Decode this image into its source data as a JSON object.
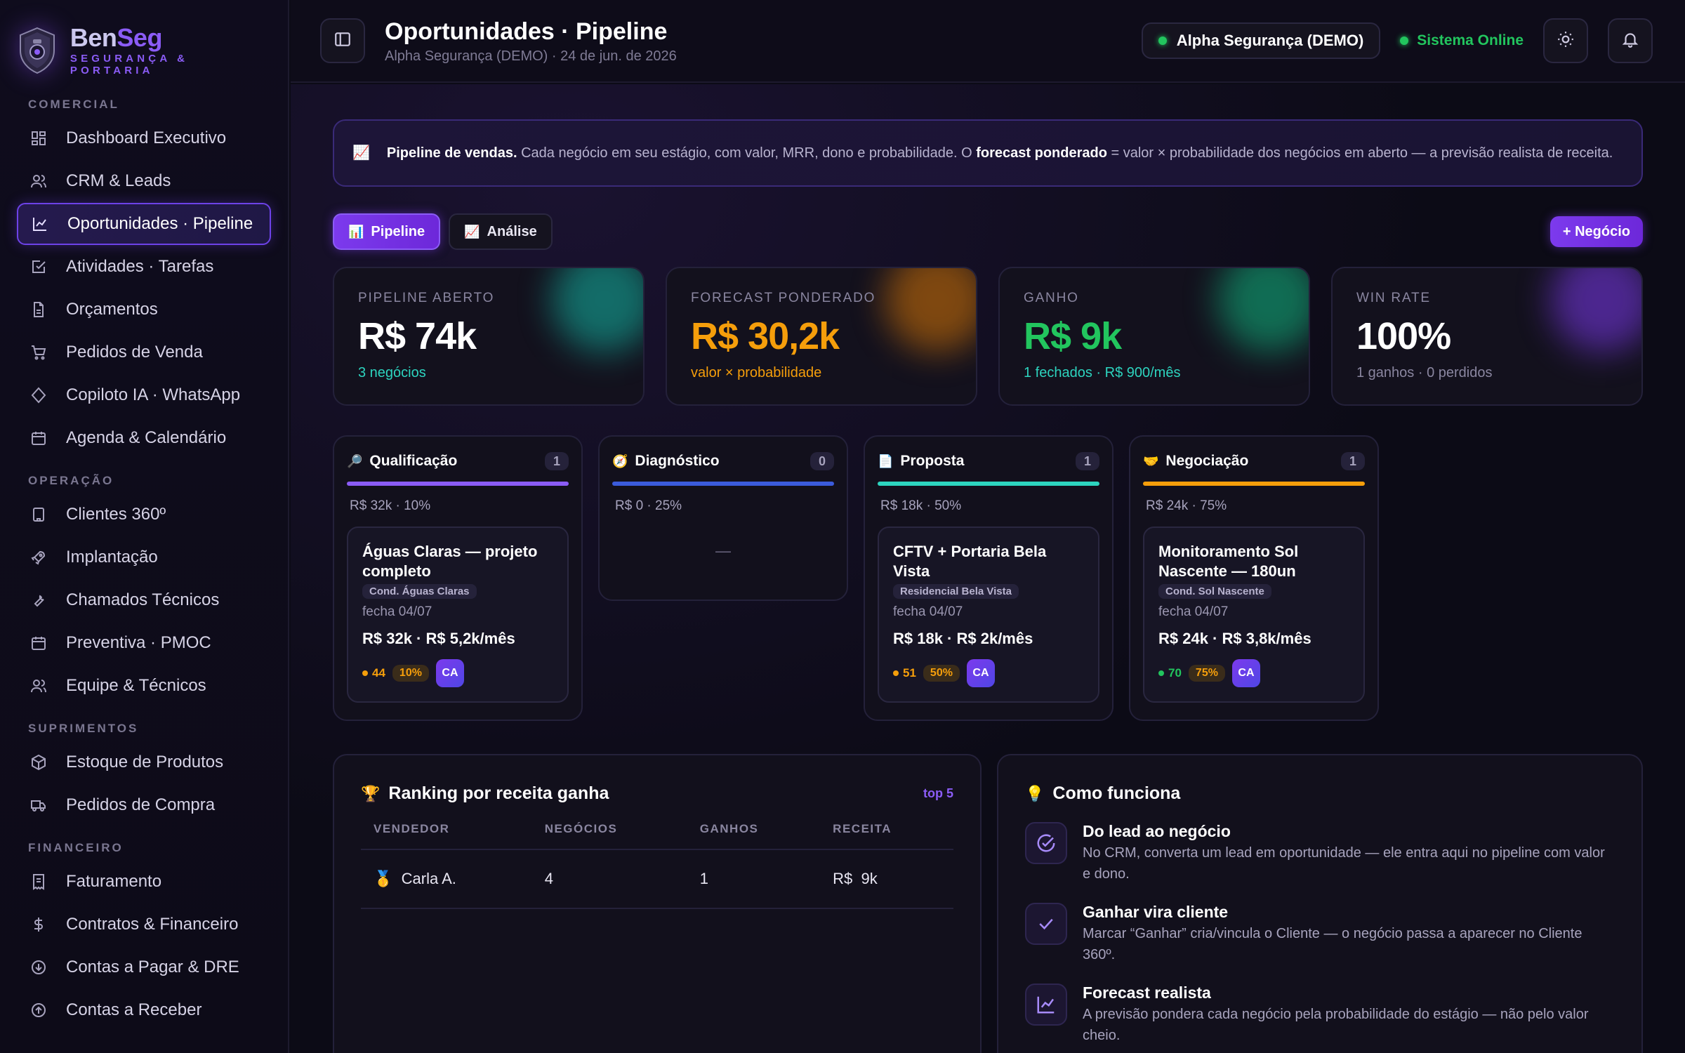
{
  "brand": {
    "name_part1": "Ben",
    "name_part2": "Seg",
    "subtitle": "SEGURANÇA & PORTARIA"
  },
  "sidebar": {
    "sections": [
      {
        "label": "COMERCIAL",
        "items": [
          {
            "label": "Dashboard Executivo",
            "icon": "grid-icon"
          },
          {
            "label": "CRM & Leads",
            "icon": "users-icon"
          },
          {
            "label": "Oportunidades · Pipeline",
            "icon": "trend-icon",
            "active": true
          },
          {
            "label": "Atividades · Tarefas",
            "icon": "task-icon"
          },
          {
            "label": "Orçamentos",
            "icon": "document-icon"
          },
          {
            "label": "Pedidos de Venda",
            "icon": "cart-icon"
          },
          {
            "label": "Copiloto IA · WhatsApp",
            "icon": "diamond-icon"
          },
          {
            "label": "Agenda & Calendário",
            "icon": "calendar-icon"
          }
        ]
      },
      {
        "label": "OPERAÇÃO",
        "items": [
          {
            "label": "Clientes 360º",
            "icon": "building-icon"
          },
          {
            "label": "Implantação",
            "icon": "rocket-icon"
          },
          {
            "label": "Chamados Técnicos",
            "icon": "wrench-icon"
          },
          {
            "label": "Preventiva · PMOC",
            "icon": "calendar-icon"
          },
          {
            "label": "Equipe & Técnicos",
            "icon": "users-icon"
          }
        ]
      },
      {
        "label": "SUPRIMENTOS",
        "items": [
          {
            "label": "Estoque de Produtos",
            "icon": "box-icon"
          },
          {
            "label": "Pedidos de Compra",
            "icon": "truck-icon"
          }
        ]
      },
      {
        "label": "FINANCEIRO",
        "items": [
          {
            "label": "Faturamento",
            "icon": "receipt-icon"
          },
          {
            "label": "Contratos & Financeiro",
            "icon": "dollar-icon"
          },
          {
            "label": "Contas a Pagar & DRE",
            "icon": "arrow-down-circle-icon"
          },
          {
            "label": "Contas a Receber",
            "icon": "arrow-up-circle-icon"
          }
        ]
      }
    ]
  },
  "header": {
    "title": "Oportunidades · Pipeline",
    "subtitle": "Alpha Segurança (DEMO) · 24 de jun. de 2026",
    "tenant": "Alpha Segurança (DEMO)",
    "status": "Sistema Online"
  },
  "banner": {
    "lead_bold": "Pipeline de vendas.",
    "text1": " Cada negócio em seu estágio, com valor, MRR, dono e probabilidade. O ",
    "bold2": "forecast ponderado",
    "text2": " = valor × probabilidade dos negócios em aberto — a previsão realista de receita."
  },
  "tabs": [
    {
      "label": "Pipeline",
      "icon": "📊"
    },
    {
      "label": "Análise",
      "icon": "📈"
    }
  ],
  "new_deal_label": "+ Negócio",
  "kpis": [
    {
      "label": "PIPELINE ABERTO",
      "value": "R$ 74k",
      "sub": "3 negócios",
      "value_color": "#ffffff",
      "sub_color": "#2dd4bf",
      "glow": "#14b8a6"
    },
    {
      "label": "FORECAST PONDERADO",
      "value": "R$ 30,2k",
      "sub": "valor × probabilidade",
      "value_color": "#f59e0b",
      "sub_color": "#f59e0b",
      "glow": "#d97706"
    },
    {
      "label": "GANHO",
      "value": "R$ 9k",
      "sub": "1 fechados · R$ 900/mês",
      "value_color": "#22c55e",
      "sub_color": "#2dd4bf",
      "glow": "#10b981"
    },
    {
      "label": "WIN RATE",
      "value": "100%",
      "sub": "1 ganhos · 0 perdidos",
      "value_color": "#ffffff",
      "sub_color": "#8a86a0",
      "glow": "#7c3aed"
    }
  ],
  "columns": [
    {
      "name": "Qualificação",
      "icon": "🔎",
      "count": "1",
      "meta": "R$ 32k · 10%",
      "color": "#8b5cf6",
      "deals": [
        {
          "title": "Águas Claras — projeto completo",
          "tag": "Cond. Águas Claras",
          "date": "fecha 04/07",
          "value": "R$ 32k · R$ 5,2k/mês",
          "score": "44",
          "score_color": "#f59e0b",
          "prob": "10%",
          "owner": "CA"
        }
      ]
    },
    {
      "name": "Diagnóstico",
      "icon": "🧭",
      "count": "0",
      "meta": "R$ 0 · 25%",
      "color": "#3b5bdb",
      "empty": "—",
      "deals": []
    },
    {
      "name": "Proposta",
      "icon": "📄",
      "count": "1",
      "meta": "R$ 18k · 50%",
      "color": "#2dd4bf",
      "deals": [
        {
          "title": "CFTV + Portaria Bela Vista",
          "tag": "Residencial Bela Vista",
          "date": "fecha 04/07",
          "value": "R$ 18k · R$ 2k/mês",
          "score": "51",
          "score_color": "#f59e0b",
          "prob": "50%",
          "owner": "CA"
        }
      ]
    },
    {
      "name": "Negociação",
      "icon": "🤝",
      "count": "1",
      "meta": "R$ 24k · 75%",
      "color": "#f59e0b",
      "deals": [
        {
          "title": "Monitoramento Sol Nascente — 180un",
          "tag": "Cond. Sol Nascente",
          "date": "fecha 04/07",
          "value": "R$ 24k · R$ 3,8k/mês",
          "score": "70",
          "score_color": "#22c55e",
          "prob": "75%",
          "owner": "CA"
        }
      ]
    }
  ],
  "ranking": {
    "title": "Ranking por receita ganha",
    "icon": "🏆",
    "link": "top 5",
    "headers": [
      "VENDEDOR",
      "NEGÓCIOS",
      "GANHOS",
      "RECEITA"
    ],
    "rows": [
      {
        "medal": "🥇",
        "name": "Carla A.",
        "deals": "4",
        "won": "1",
        "revenue": "R$  9k"
      }
    ]
  },
  "how": {
    "title": "Como funciona",
    "icon": "💡",
    "items": [
      {
        "title": "Do lead ao negócio",
        "text": "No CRM, converta um lead em oportunidade — ele entra aqui no pipeline com valor e dono.",
        "icon": "check-circle-icon"
      },
      {
        "title": "Ganhar vira cliente",
        "text": "Marcar “Ganhar” cria/vincula o Cliente — o negócio passa a aparecer no Cliente 360º.",
        "icon": "check-icon"
      },
      {
        "title": "Forecast realista",
        "text": "A previsão pondera cada negócio pela probabilidade do estágio — não pelo valor cheio.",
        "icon": "chart-icon"
      }
    ]
  }
}
